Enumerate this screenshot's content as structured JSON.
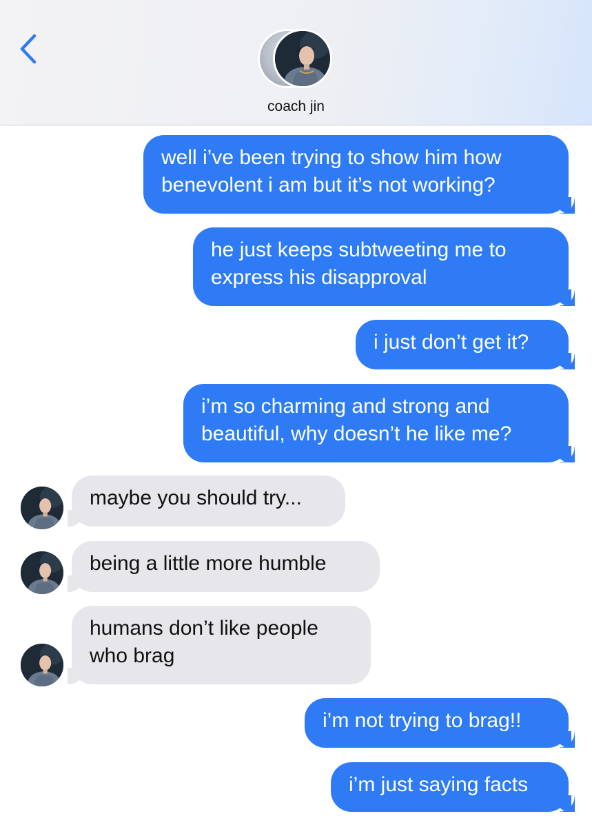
{
  "header": {
    "contact_name": "coach jin",
    "back_icon": "chevron-left-icon",
    "accent_color": "#2f7bf5"
  },
  "messages": [
    {
      "from": "me",
      "lines": [
        "well i’ve been trying to show him how",
        "benevolent i am but it’s not working?"
      ]
    },
    {
      "from": "me",
      "lines": [
        "he just keeps subtweeting me to",
        "express his disapproval"
      ]
    },
    {
      "from": "me",
      "lines": [
        "i just don’t get it?"
      ]
    },
    {
      "from": "me",
      "lines": [
        "i’m so charming and strong and",
        "beautiful, why doesn’t he like me?"
      ]
    },
    {
      "from": "them",
      "lines": [
        "maybe you should try..."
      ]
    },
    {
      "from": "them",
      "lines": [
        "being a little more humble"
      ]
    },
    {
      "from": "them",
      "lines": [
        "humans don’t like people",
        "who brag"
      ]
    },
    {
      "from": "me",
      "lines": [
        "i’m not trying to brag!!"
      ]
    },
    {
      "from": "me",
      "lines": [
        "i’m just saying facts"
      ]
    }
  ],
  "colors": {
    "sent_bubble": "#2f7bf5",
    "received_bubble": "#e6e6eb",
    "header_bg": "#f3f3f5"
  }
}
